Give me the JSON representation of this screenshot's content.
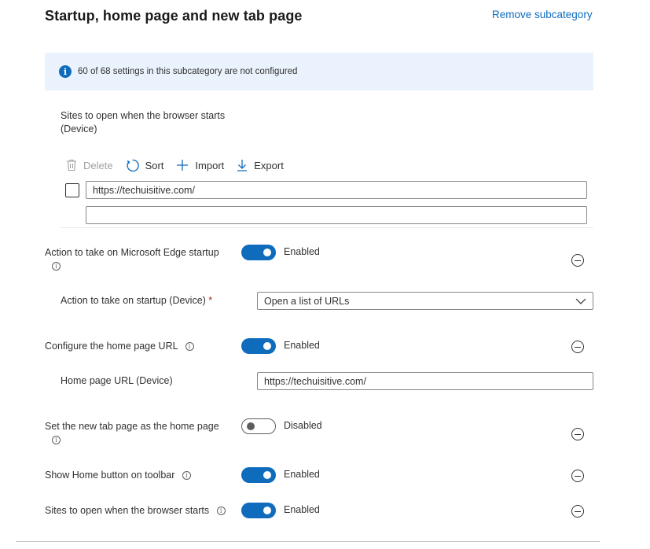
{
  "header": {
    "title": "Startup, home page and new tab page",
    "remove_link": "Remove subcategory"
  },
  "info_bar": {
    "icon": "info-icon",
    "text": "60 of 68 settings in this subcategory are not configured"
  },
  "sites_list": {
    "label_line1": "Sites to open when the browser starts",
    "label_line2": "(Device)",
    "toolbar": {
      "delete": "Delete",
      "sort": "Sort",
      "import": "Import",
      "export": "Export"
    },
    "rows": [
      {
        "value": "https://techuisitive.com/",
        "checked": false
      },
      {
        "value": "",
        "checked": false
      }
    ]
  },
  "settings": {
    "edge_startup": {
      "label": "Action to take on Microsoft Edge startup",
      "state": "Enabled",
      "on": true
    },
    "startup_action": {
      "label": "Action to take on startup (Device)",
      "required_mark": "*",
      "selected": "Open a list of URLs"
    },
    "home_page_url": {
      "label": "Configure the home page URL",
      "state": "Enabled",
      "on": true
    },
    "home_page_value": {
      "label": "Home page URL (Device)",
      "value": "https://techuisitive.com/"
    },
    "new_tab_home": {
      "label": "Set the new tab page as the home page",
      "state": "Disabled",
      "on": false
    },
    "home_button": {
      "label": "Show Home button on toolbar",
      "state": "Enabled",
      "on": true
    },
    "sites_startup": {
      "label": "Sites to open when the browser starts",
      "state": "Enabled",
      "on": true
    }
  },
  "colors": {
    "accent": "#0f6cbd",
    "info_background": "#eaf3fd",
    "required": "#a4262c"
  }
}
